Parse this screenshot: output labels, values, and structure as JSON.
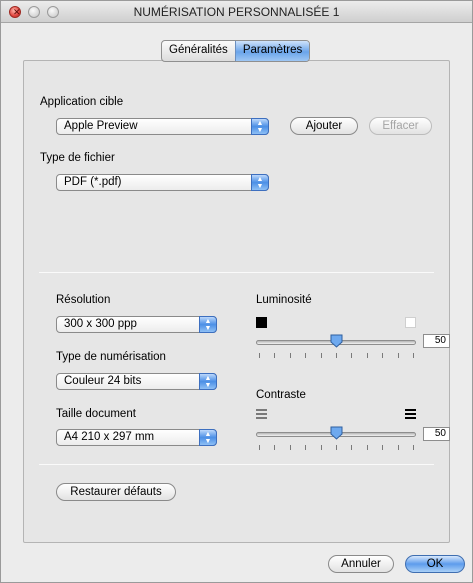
{
  "window": {
    "title": "NUMÉRISATION PERSONNALISÉE 1"
  },
  "tabs": [
    {
      "label": "Généralités",
      "selected": false
    },
    {
      "label": "Paramètres",
      "selected": true
    }
  ],
  "app_target": {
    "label": "Application cible",
    "value": "Apple Preview",
    "add_label": "Ajouter",
    "delete_label": "Effacer"
  },
  "file_type": {
    "label": "Type de fichier",
    "value": "PDF (*.pdf)"
  },
  "resolution": {
    "label": "Résolution",
    "value": "300 x 300 ppp"
  },
  "scan_type": {
    "label": "Type de numérisation",
    "value": "Couleur 24 bits"
  },
  "document_size": {
    "label": "Taille document",
    "value": "A4 210 x 297 mm"
  },
  "brightness": {
    "label": "Luminosité",
    "value": "50",
    "level": 0.5
  },
  "contrast": {
    "label": "Contraste",
    "value": "50",
    "level": 0.5
  },
  "restore_label": "Restaurer défauts",
  "footer": {
    "cancel_label": "Annuler",
    "ok_label": "OK"
  },
  "colors": {
    "accent": "#5d9cec"
  },
  "icons": {
    "close": "close-icon",
    "popup_arrows": "updown-arrows-icon",
    "brightness_low": "black-square-icon",
    "brightness_high": "white-square-icon",
    "contrast_low": "low-contrast-icon",
    "contrast_high": "high-contrast-icon"
  }
}
